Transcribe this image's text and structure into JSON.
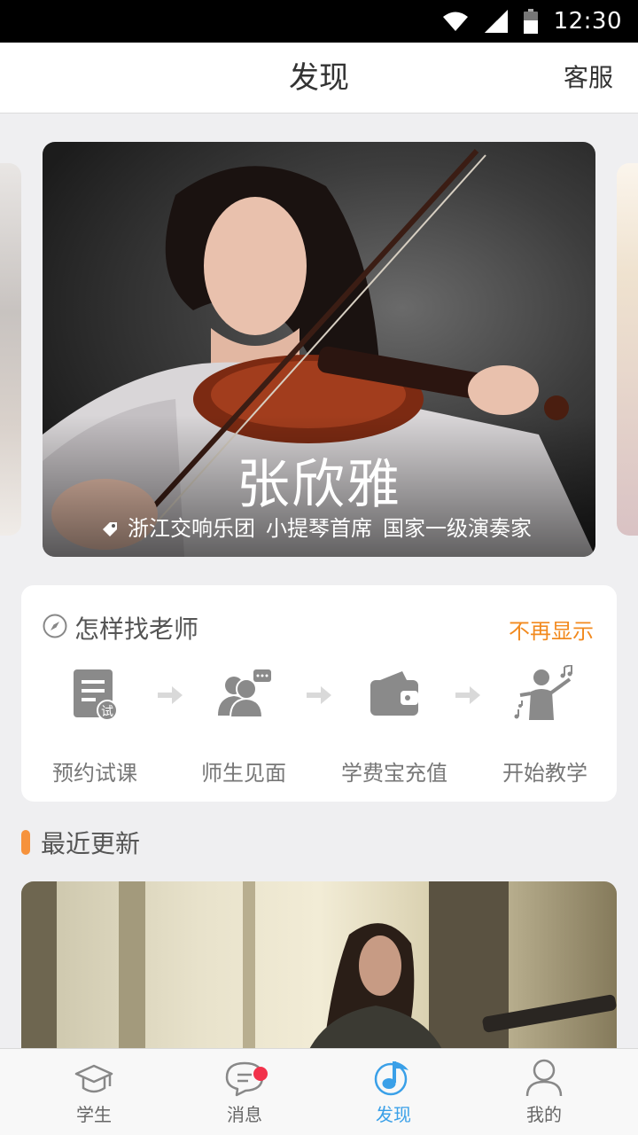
{
  "status_bar": {
    "time": "12:30"
  },
  "header": {
    "title": "发现",
    "customer_service": "客服"
  },
  "featured": {
    "name": "张欣雅",
    "tags": [
      "浙江交响乐团",
      "小提琴首席",
      "国家一级演奏家"
    ]
  },
  "guide": {
    "title": "怎样找老师",
    "dismiss": "不再显示",
    "steps": [
      {
        "label": "预约试课",
        "icon": "trial-lesson-icon",
        "badge": "试"
      },
      {
        "label": "师生见面",
        "icon": "meeting-icon"
      },
      {
        "label": "学费宝充值",
        "icon": "wallet-icon"
      },
      {
        "label": "开始教学",
        "icon": "teaching-icon"
      }
    ]
  },
  "recent": {
    "title": "最近更新"
  },
  "tabs": [
    {
      "label": "学生",
      "icon": "graduation-cap-icon"
    },
    {
      "label": "消息",
      "icon": "chat-icon"
    },
    {
      "label": "发现",
      "icon": "music-note-icon"
    },
    {
      "label": "我的",
      "icon": "user-icon"
    }
  ],
  "colors": {
    "accent": "#3aa0e8",
    "orange": "#f28a1f",
    "badge": "#f2324b"
  }
}
